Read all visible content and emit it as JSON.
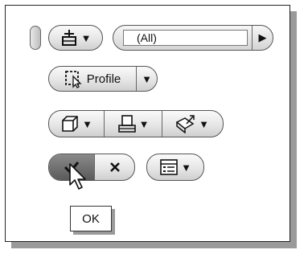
{
  "filter": {
    "selected": "(All)"
  },
  "profile": {
    "label": "Profile"
  },
  "actions": {
    "ok_tooltip": "OK"
  },
  "icons": {
    "selection_filter": "selection-filter-icon",
    "profile": "profile-icon",
    "solid": "solid-icon",
    "output_plane": "output-plane-icon",
    "surface": "surface-icon",
    "ok": "checkmark-icon",
    "cancel": "x-icon",
    "options": "options-menu-icon",
    "arrow_down": "chevron-down-icon",
    "arrow_right": "chevron-right-icon"
  }
}
